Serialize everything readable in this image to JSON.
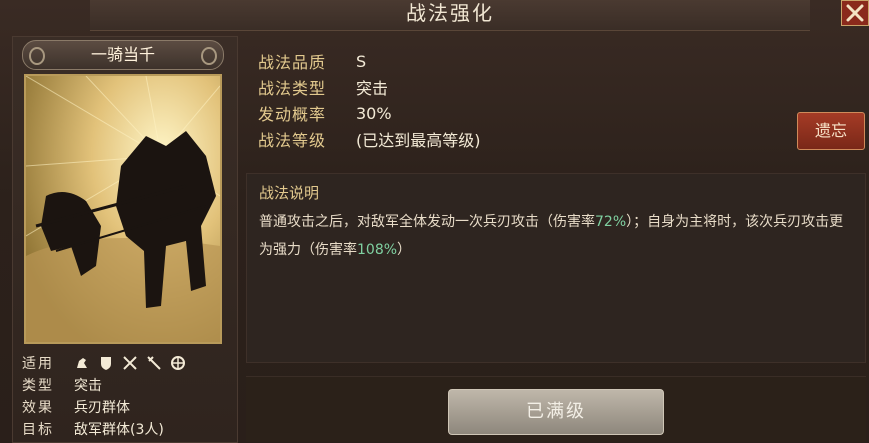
{
  "window": {
    "title": "战法强化",
    "close_icon": "close-icon"
  },
  "tactic": {
    "name": "一骑当千",
    "applicable_label": "适用",
    "applicable_icons": [
      "cavalry-icon",
      "shield-icon",
      "spear-icon",
      "bow-icon",
      "wheel-icon"
    ],
    "type_label": "类型",
    "type_value": "突击",
    "effect_label": "效果",
    "effect_value": "兵刃群体",
    "target_label": "目标",
    "target_value": "敌军群体(3人)"
  },
  "info": {
    "quality_label": "战法品质",
    "quality_value": "S",
    "category_label": "战法类型",
    "category_value": "突击",
    "rate_label": "发动概率",
    "rate_value": "30%",
    "level_label": "战法等级",
    "level_value": "(已达到最高等级)"
  },
  "forget_button": "遗忘",
  "description": {
    "title": "战法说明",
    "part1": "普通攻击之后，对敌军全体发动一次兵刃攻击（伤害率",
    "rate1": "72%",
    "part2": "）；自身为主将时，该次兵刃攻击更为强力（伤害率",
    "rate2": "108%",
    "part3": "）"
  },
  "max_level_button": "已满级",
  "colors": {
    "accent_gold": "#e2c98e",
    "highlight_green": "#7fd0a0",
    "forget_red": "#a53b26"
  }
}
